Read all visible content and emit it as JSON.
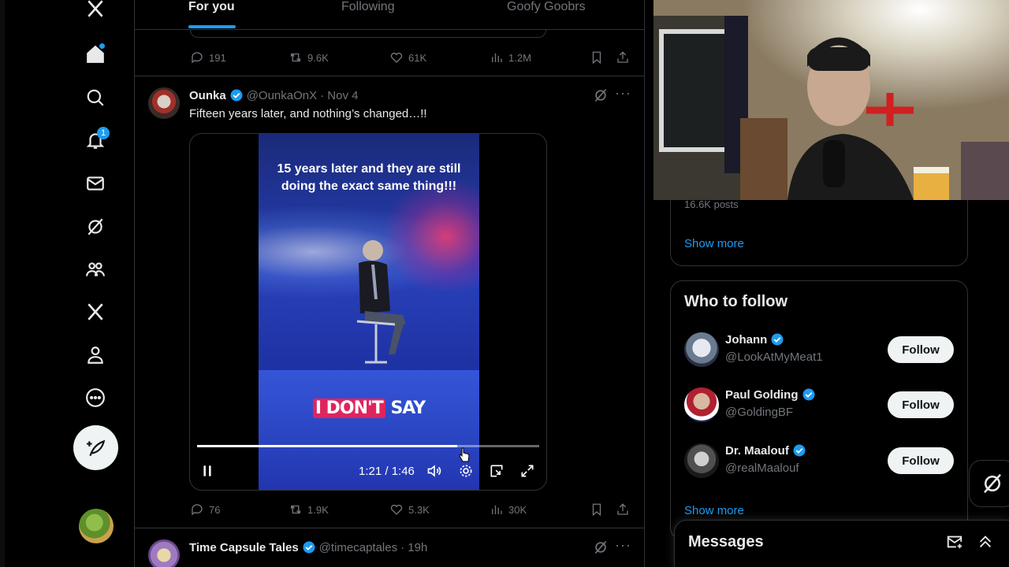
{
  "nav": {
    "notifications_badge": "1"
  },
  "tabs": [
    {
      "label": "For you",
      "active": true
    },
    {
      "label": "Following",
      "active": false
    },
    {
      "label": "Goofy Goobrs",
      "active": false
    }
  ],
  "prev_tweet": {
    "replies": "191",
    "reposts": "9.6K",
    "likes": "61K",
    "views": "1.2M"
  },
  "tweet": {
    "name": "Ounka",
    "handle": "@OunkaOnX",
    "date": "· Nov 4",
    "text": "Fifteen years later, and nothing’s changed…!!",
    "video": {
      "caption_top": "15 years later and they are still doing the exact same thing!!!",
      "caption_bottom_highlight": "I DON'T",
      "caption_bottom_rest": " SAY",
      "time": "1:21 / 1:46",
      "progress": 0.76
    },
    "replies": "76",
    "reposts": "1.9K",
    "likes": "5.3K",
    "views": "30K"
  },
  "next_tweet": {
    "name": "Time Capsule Tales",
    "handle": "@timecaptales",
    "date": "· 19h"
  },
  "trends": {
    "posts_count": "16.6K posts",
    "show_more": "Show more"
  },
  "who_to_follow": {
    "title": "Who to follow",
    "users": [
      {
        "name": "Johann",
        "handle": "@LookAtMyMeat1",
        "button": "Follow"
      },
      {
        "name": "Paul Golding",
        "handle": "@GoldingBF",
        "button": "Follow"
      },
      {
        "name": "Dr. Maalouf",
        "handle": "@realMaalouf",
        "button": "Follow"
      }
    ],
    "show_more": "Show more"
  },
  "messages": {
    "title": "Messages"
  },
  "colors": {
    "accent": "#1d9bf0",
    "background": "#000000",
    "border": "#2f3336",
    "muted_text": "#71767b"
  }
}
